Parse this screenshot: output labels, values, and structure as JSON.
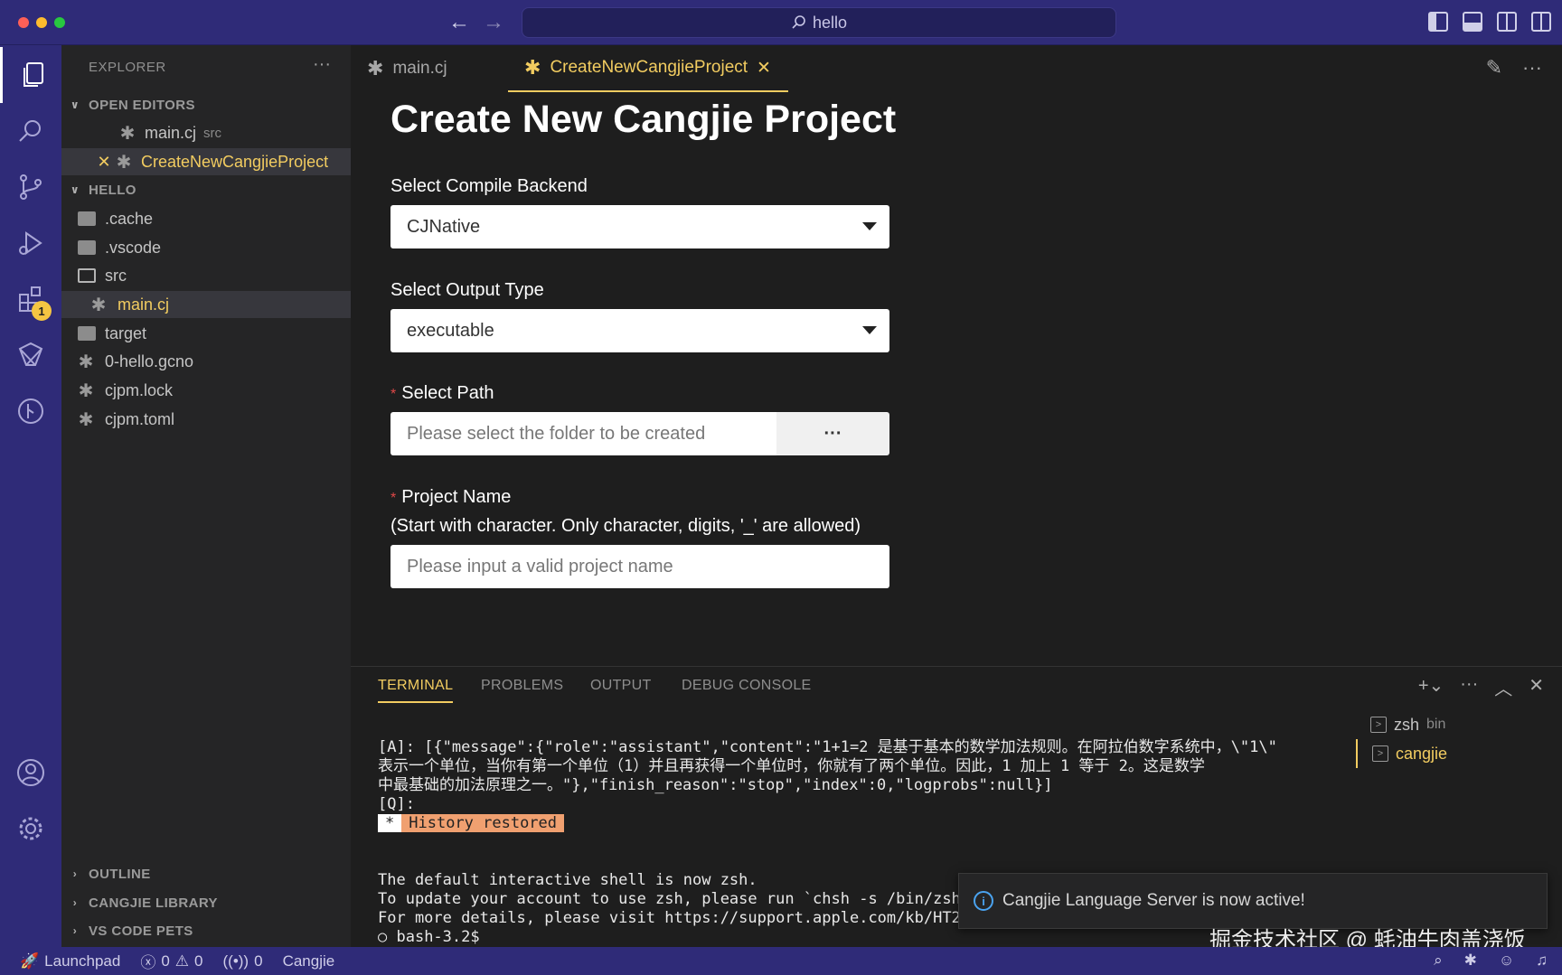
{
  "window": {
    "search": "hello"
  },
  "explorer": {
    "title": "EXPLORER",
    "open_editors_label": "OPEN EDITORS",
    "open_editors": [
      {
        "name": "main.cj",
        "hint": "src"
      },
      {
        "name": "CreateNewCangjieProject"
      }
    ],
    "workspace_label": "HELLO",
    "files": [
      {
        "name": ".cache",
        "kind": "folder"
      },
      {
        "name": ".vscode",
        "kind": "folder"
      },
      {
        "name": "src",
        "kind": "folder-open"
      },
      {
        "name": "main.cj",
        "kind": "file"
      },
      {
        "name": "target",
        "kind": "folder"
      },
      {
        "name": "0-hello.gcno",
        "kind": "file"
      },
      {
        "name": "cjpm.lock",
        "kind": "file"
      },
      {
        "name": "cjpm.toml",
        "kind": "file"
      }
    ],
    "outline_label": "OUTLINE",
    "cangjie_library_label": "CANGJIE LIBRARY",
    "vscode_pets_label": "VS CODE PETS"
  },
  "activity": {
    "extensions_badge": "1"
  },
  "tabs": [
    {
      "label": "main.cj"
    },
    {
      "label": "CreateNewCangjieProject"
    }
  ],
  "form": {
    "title": "Create New Cangjie Project",
    "backend_label": "Select Compile Backend",
    "backend_value": "CJNative",
    "output_label": "Select Output Type",
    "output_value": "executable",
    "path_label": "Select Path",
    "path_placeholder": "Please select the folder to be created",
    "browse_label": "···",
    "name_label": "Project Name",
    "name_hint": "(Start with character. Only character, digits, '_' are allowed)",
    "name_placeholder": "Please input a valid project name",
    "required_mark": "*"
  },
  "panel": {
    "tabs": [
      "TERMINAL",
      "PROBLEMS",
      "OUTPUT",
      "DEBUG CONSOLE"
    ],
    "terminal_lines": [
      "[A]: [{\"message\":{\"role\":\"assistant\",\"content\":\"1+1=2 是基于基本的数学加法规则。在阿拉伯数字系统中，\\\"1\\\"",
      "表示一个单位，当你有第一个单位（1）并且再获得一个单位时，你就有了两个单位。因此，1 加上 1 等于 2。这是数学",
      "中最基础的加法原理之一。\"},\"finish_reason\":\"stop\",\"index\":0,\"logprobs\":null}]",
      "",
      "[Q]:"
    ],
    "history_star": "*",
    "history_text": "History restored",
    "shell_lines": [
      "The default interactive shell is now zsh.",
      "To update your account to use zsh, please run `chsh -s /bin/zsh`.",
      "For more details, please visit https://support.apple.com/kb/HT208050.",
      "bash-3.2$"
    ],
    "terminals": [
      {
        "name": "zsh",
        "hint": "bin"
      },
      {
        "name": "cangjie"
      }
    ]
  },
  "notification": {
    "text": "Cangjie Language Server is now active!"
  },
  "watermark": "掘金技术社区 @ 蚝油牛肉盖浇饭",
  "statusbar": {
    "launchpad": "Launchpad",
    "errors": "0",
    "warnings": "0",
    "ports": "0",
    "language": "Cangjie"
  },
  "colors": {
    "accent": "#f2cc60",
    "chrome": "#2f2b78",
    "required": "#e04848",
    "history_bg": "#f0a070"
  }
}
